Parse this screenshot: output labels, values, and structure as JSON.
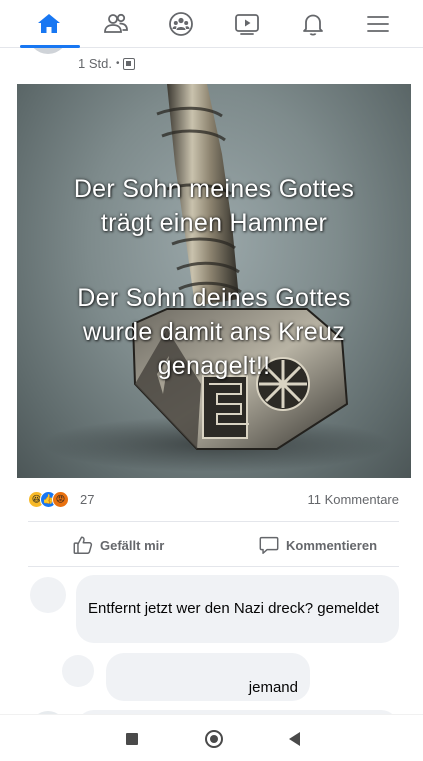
{
  "nav": {
    "items": [
      {
        "name": "home",
        "active": true
      },
      {
        "name": "friends",
        "active": false
      },
      {
        "name": "groups",
        "active": false
      },
      {
        "name": "watch",
        "active": false
      },
      {
        "name": "notifications",
        "active": false
      },
      {
        "name": "menu",
        "active": false
      }
    ],
    "accent": "#1877f2",
    "icon_color": "#65676b"
  },
  "post": {
    "time": "1 Std.",
    "separator": "•",
    "image_text_1": "Der Sohn meines Gottes\nträgt einen Hammer",
    "image_text_2": "Der Sohn deines Gottes\nwurde damit ans Kreuz\ngenagelt!!",
    "reaction_icons": [
      "haha",
      "like",
      "angry"
    ],
    "reaction_count": "27",
    "comment_count": "11 Kommentare",
    "like_label": "Gefällt mir",
    "comment_label": "Kommentieren"
  },
  "comments": [
    {
      "text": "Entfernt jetzt wer den Nazi dreck? gemeldet"
    },
    {
      "text": "jemand"
    }
  ],
  "system_nav": {
    "buttons": [
      "recents",
      "home",
      "back"
    ]
  }
}
